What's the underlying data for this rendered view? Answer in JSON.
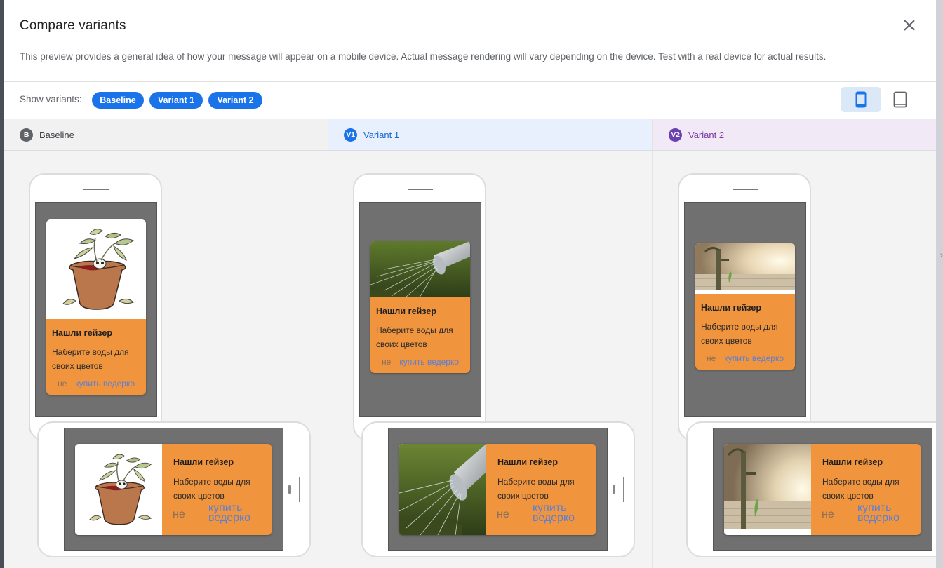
{
  "dialog": {
    "title": "Compare variants",
    "description": "This preview provides a general idea of how your message will appear on a mobile device. Actual message rendering will vary depending on the device. Test with a real device for actual results."
  },
  "toolbar": {
    "show_variants_label": "Show variants:",
    "chips": [
      "Baseline",
      "Variant 1",
      "Variant 2"
    ]
  },
  "columns": [
    {
      "badge": "B",
      "name": "Baseline",
      "image": "plant-pot-illustration"
    },
    {
      "badge": "V1",
      "name": "Variant 1",
      "image": "watering-can-photo"
    },
    {
      "badge": "V2",
      "name": "Variant 2",
      "image": "water-pump-photo"
    }
  ],
  "message": {
    "title": "Нашли гейзер",
    "body": "Наберите воды для своих цветов",
    "dismiss": "не",
    "action": "купить ведерко"
  },
  "colors": {
    "primary": "#1a73e8",
    "card": "#f0943e",
    "screen": "#707070"
  }
}
